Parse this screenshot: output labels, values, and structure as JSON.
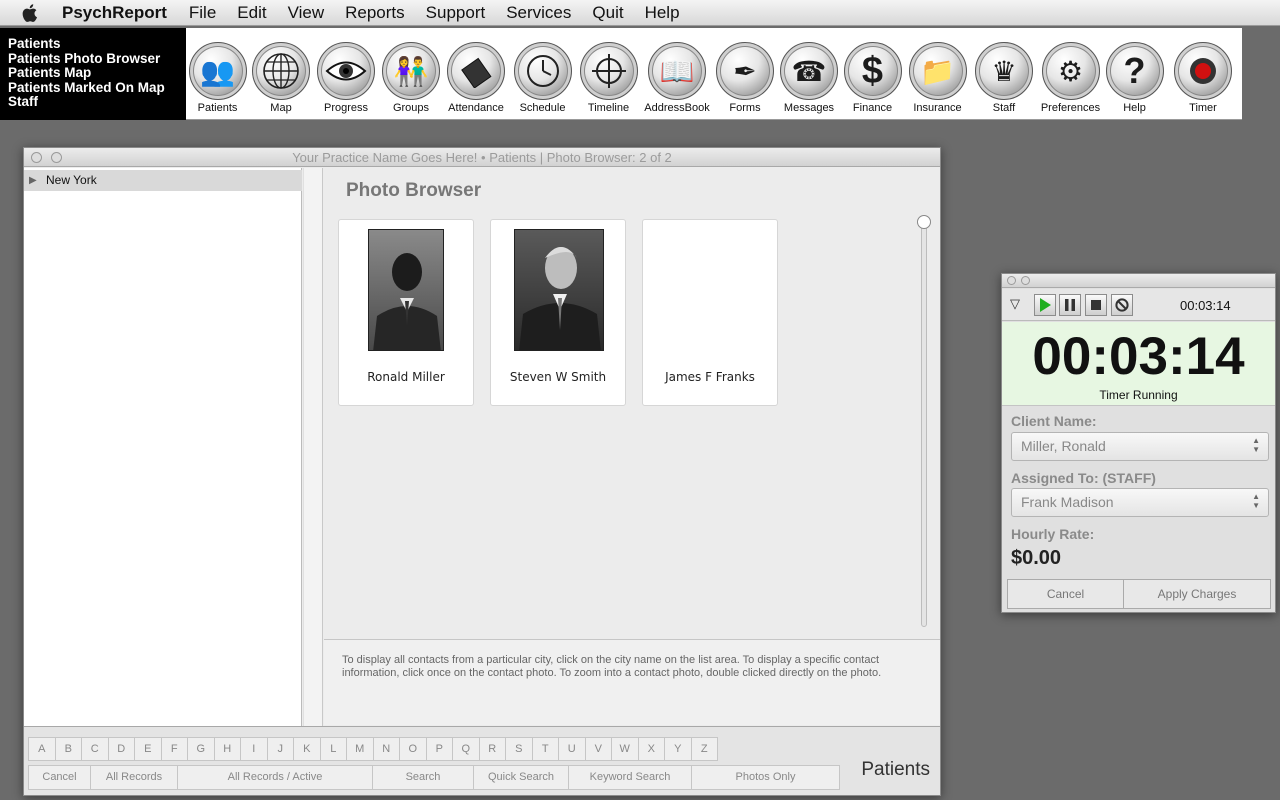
{
  "menubar": {
    "app_name": "PsychReport",
    "items": [
      "File",
      "Edit",
      "View",
      "Reports",
      "Support",
      "Services",
      "Quit",
      "Help"
    ]
  },
  "quick_links": [
    "Patients",
    "Patients Photo Browser",
    "Patients Map",
    "Patients Marked On Map",
    "Staff"
  ],
  "toolbar": [
    {
      "label": "Patients",
      "icon": "people-icon"
    },
    {
      "label": "Map",
      "icon": "globe-icon"
    },
    {
      "label": "Progress",
      "icon": "eye-icon"
    },
    {
      "label": "Groups",
      "icon": "couple-icon"
    },
    {
      "label": "Attendance",
      "icon": "clipboard-icon"
    },
    {
      "label": "Schedule",
      "icon": "clock-icon"
    },
    {
      "label": "Timeline",
      "icon": "crosshair-icon"
    },
    {
      "label": "AddressBook",
      "icon": "book-icon"
    },
    {
      "label": "Forms",
      "icon": "pen-icon"
    },
    {
      "label": "Messages",
      "icon": "telephone-icon"
    },
    {
      "label": "Finance",
      "icon": "dollar-icon"
    },
    {
      "label": "Insurance",
      "icon": "folder-icon"
    },
    {
      "label": "Staff",
      "icon": "crown-icon"
    },
    {
      "label": "Preferences",
      "icon": "gears-icon"
    },
    {
      "label": "Help",
      "icon": "question-icon"
    },
    {
      "label": "Timer",
      "icon": "record-icon"
    }
  ],
  "main_window": {
    "title": "Your Practice Name Goes Here!  •  Patients | Photo Browser: 2 of 2",
    "sidebar": {
      "city": "New York"
    },
    "content_title": "Photo Browser",
    "photos": [
      {
        "name": "Ronald Miller",
        "has_photo": true
      },
      {
        "name": "Steven W Smith",
        "has_photo": true
      },
      {
        "name": "James F Franks",
        "has_photo": false
      }
    ],
    "help_text": "To display all contacts from a particular city, click on the city name on the list area. To display a specific contact information, click once on the contact photo. To zoom into a contact photo, double clicked directly on the photo.",
    "letters": [
      "A",
      "B",
      "C",
      "D",
      "E",
      "F",
      "G",
      "H",
      "I",
      "J",
      "K",
      "L",
      "M",
      "N",
      "O",
      "P",
      "Q",
      "R",
      "S",
      "T",
      "U",
      "V",
      "W",
      "X",
      "Y",
      "Z"
    ],
    "actions": [
      "Cancel",
      "All Records",
      "All Records / Active",
      "Search",
      "Quick Search",
      "Keyword Search",
      "Photos Only"
    ],
    "section_label": "Patients"
  },
  "timer_window": {
    "small_time": "00:03:14",
    "big_time": "00:03:14",
    "status": "Timer Running",
    "client_label": "Client Name:",
    "client_value": "Miller, Ronald",
    "assigned_label": "Assigned To:   (STAFF)",
    "assigned_value": "Frank Madison",
    "rate_label": "Hourly Rate:",
    "rate_value": "$0.00",
    "cancel_label": "Cancel",
    "apply_label": "Apply Charges",
    "play_color": "#1fae1f"
  }
}
